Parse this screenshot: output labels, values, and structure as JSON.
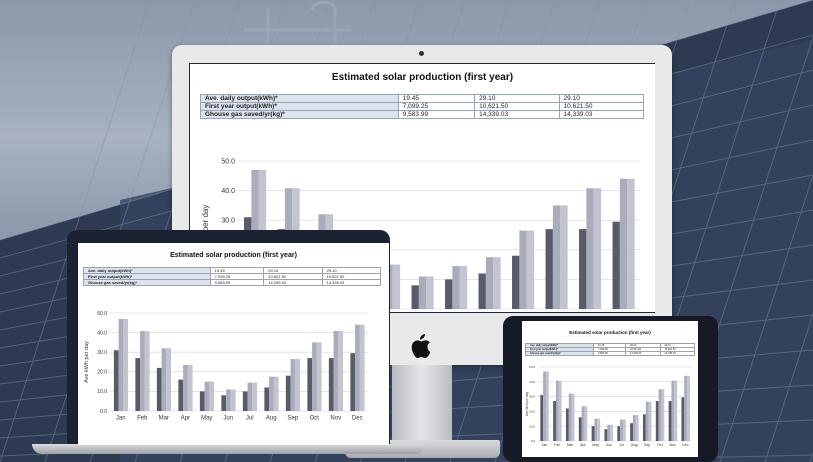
{
  "report": {
    "title": "Estimated solar production (first year)",
    "rows": [
      {
        "label": "Ave. daily output(kWh)*",
        "values": [
          "19.45",
          "29.10",
          "29.10"
        ]
      },
      {
        "label": "First year output(kWh)*",
        "values": [
          "7,099.25",
          "10,621.50",
          "10,621.50"
        ]
      },
      {
        "label": "Ghouse gas saved/yr(kg)*",
        "values": [
          "9,583.99",
          "14,339.03",
          "14,339.03"
        ]
      }
    ],
    "laptop_rows": [
      {
        "label": "Ave. daily output(kWh)*",
        "values": [
          "19.45",
          "29.10",
          "29.10"
        ]
      },
      {
        "label": "First year output(kWh)*",
        "values": [
          "7,099.25",
          "10,621.50",
          "10,621.50"
        ]
      },
      {
        "label": "Ghouse gas saved/yr(kg)*",
        "values": [
          "9,583.99",
          "14,339.03",
          "14,339.03"
        ]
      }
    ]
  },
  "imac_ylabel_fragment": "per day",
  "colors": {
    "bar_dark": "#595b6b",
    "bar_light": "#a9acbb",
    "bar_lighter": "#c2c4cf",
    "screen_bezel": "#1e2636"
  },
  "icons": {
    "apple": "apple-logo-icon",
    "camera": "camera-icon"
  },
  "chart_data": {
    "type": "bar",
    "categories": [
      "Jan",
      "Feb",
      "Mar",
      "Apr",
      "May",
      "Jun",
      "Jul",
      "Aug",
      "Sep",
      "Oct",
      "Nov",
      "Dec"
    ],
    "series": [
      {
        "values": [
          31,
          27,
          22,
          16,
          10,
          8,
          10,
          12,
          18,
          27,
          27,
          29.5
        ]
      },
      {
        "values": [
          47,
          40.8,
          32,
          23.5,
          15,
          11,
          14.5,
          17.5,
          26.5,
          35,
          40.8,
          44
        ]
      },
      {
        "values": [
          47,
          40.8,
          32,
          23.5,
          15,
          11,
          14.5,
          17.5,
          26.5,
          35,
          40.8,
          44
        ]
      }
    ],
    "ylabel": "Ave kWh per day",
    "yticks": [
      "0.0",
      "10.0",
      "20.0",
      "30.0",
      "40.0",
      "50.0"
    ],
    "ylim": [
      0,
      50
    ],
    "grid": true
  }
}
